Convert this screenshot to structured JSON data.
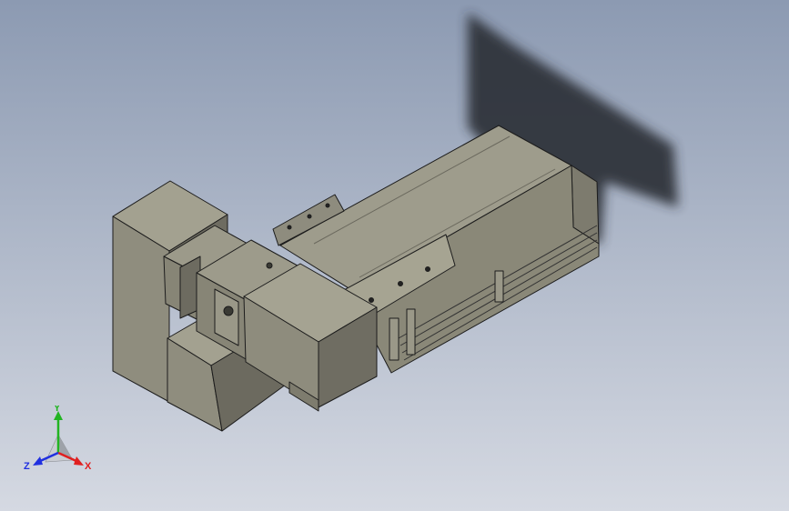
{
  "viewport": {
    "background_top": "#8c9ab2",
    "background_bottom": "#d4d9e2"
  },
  "model": {
    "body_color": "#8e8c7e",
    "face_light": "#a9a796",
    "face_dark": "#5e5c52",
    "edge_color": "#1c1c1c",
    "shadow_color": "#2b2d35"
  },
  "triad": {
    "x_label": "X",
    "y_label": "Y",
    "z_label": "Z",
    "x_color": "#e02020",
    "y_color": "#22b422",
    "z_color": "#2030e0"
  }
}
